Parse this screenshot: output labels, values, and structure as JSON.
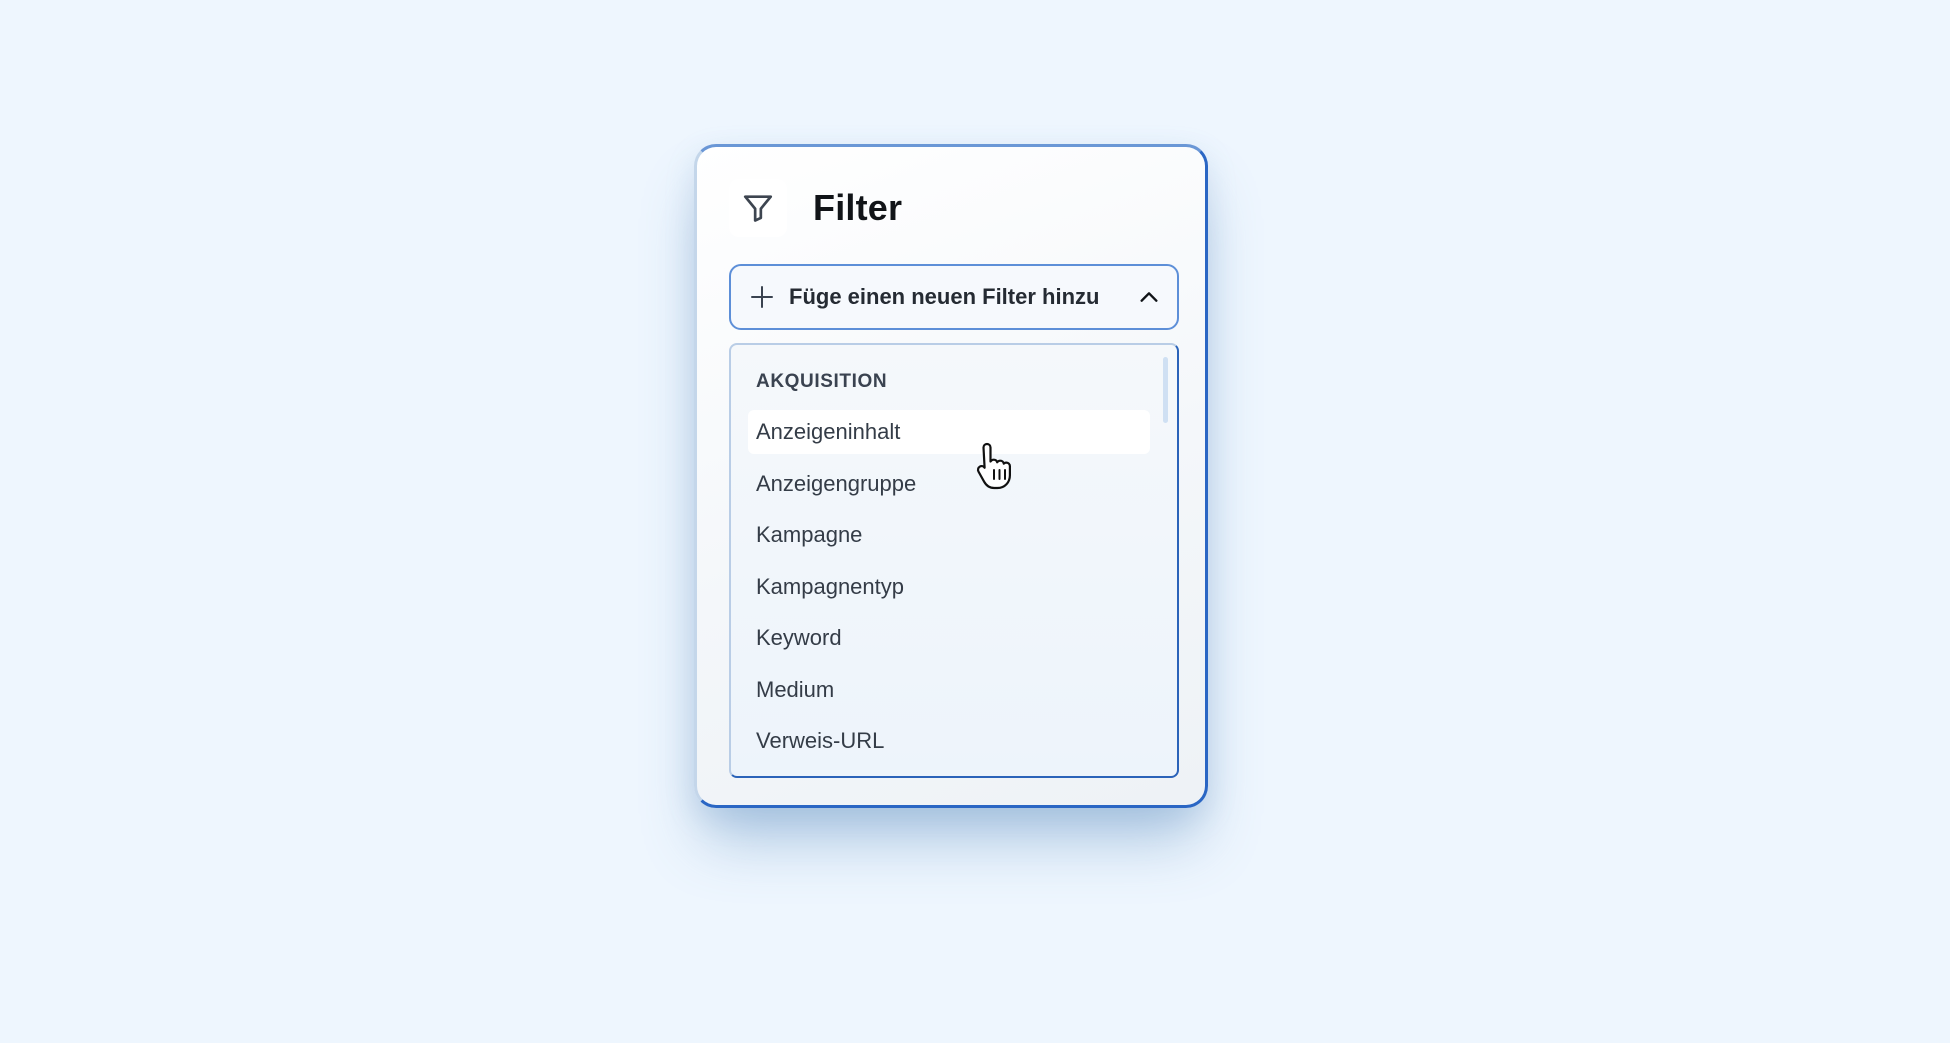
{
  "panel": {
    "title": "Filter",
    "icon": "filter-funnel-icon"
  },
  "add_filter": {
    "label": "Füge einen neuen Filter hinzu",
    "leading_icon": "plus-icon",
    "trailing_icon": "chevron-up-icon",
    "expanded": true
  },
  "dropdown": {
    "group": "AKQUISITION",
    "options": [
      {
        "label": "Anzeigeninhalt",
        "hovered": true
      },
      {
        "label": "Anzeigengruppe",
        "hovered": false
      },
      {
        "label": "Kampagne",
        "hovered": false
      },
      {
        "label": "Kampagnentyp",
        "hovered": false
      },
      {
        "label": "Keyword",
        "hovered": false
      },
      {
        "label": "Medium",
        "hovered": false
      },
      {
        "label": "Verweis-URL",
        "hovered": false
      }
    ]
  },
  "colors": {
    "page_background": "#eef6fe",
    "accent_border": "#2a66c4",
    "text_primary": "#111418",
    "text_option": "#343c47"
  }
}
